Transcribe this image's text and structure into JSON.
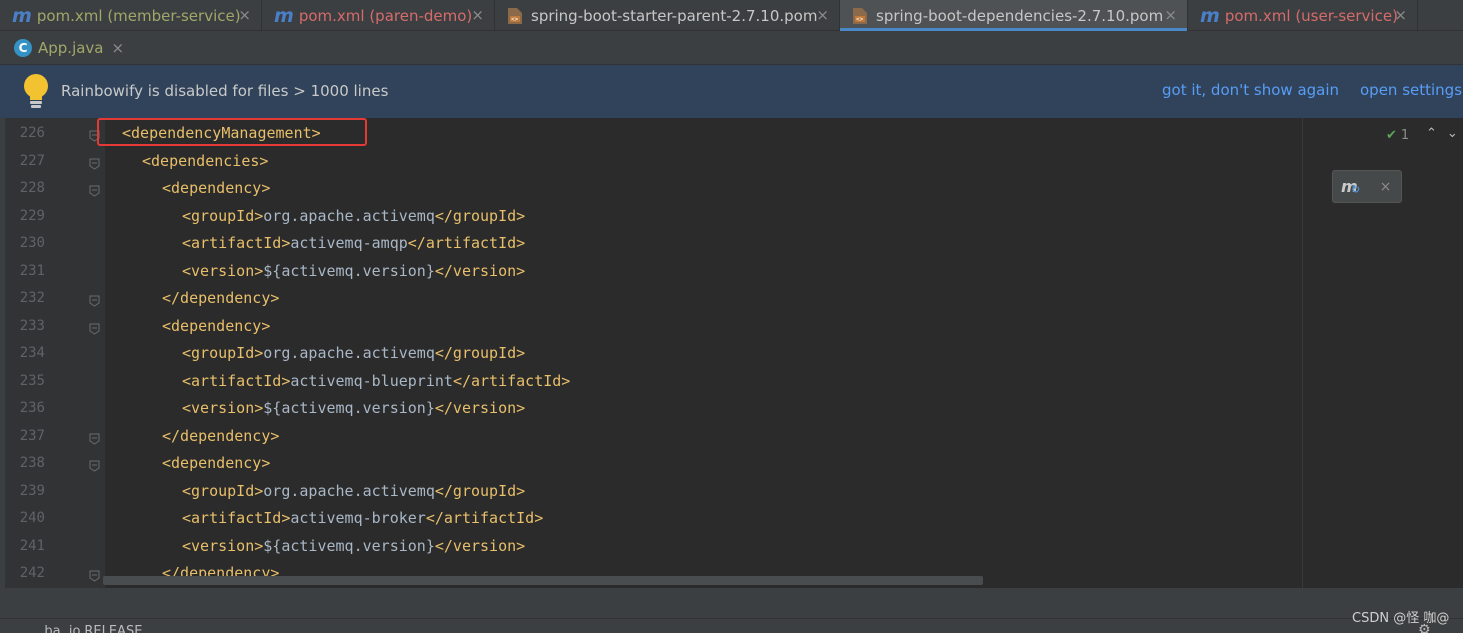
{
  "tabs": [
    {
      "label": "pom.xml (member-service)",
      "icon": "maven-icon",
      "color": "#a1a769"
    },
    {
      "label": "pom.xml (paren-demo)",
      "icon": "maven-icon",
      "color": "#d56b6b"
    },
    {
      "label": "spring-boot-starter-parent-2.7.10.pom",
      "icon": "pom-file-icon",
      "color": "#c7c7c7"
    },
    {
      "label": "spring-boot-dependencies-2.7.10.pom",
      "icon": "pom-file-icon",
      "color": "#c7c7c7",
      "active": true
    },
    {
      "label": "pom.xml (user-service)",
      "icon": "maven-icon",
      "color": "#d56b6b"
    }
  ],
  "tabs_row2": [
    {
      "label": "App.java",
      "icon": "java-class-icon"
    }
  ],
  "banner": {
    "message": "Rainbowify is disabled for files > 1000 lines",
    "link_dismiss": "got it, don't show again",
    "link_settings": "open settings"
  },
  "editor": {
    "lines": [
      {
        "num": "226",
        "indent": 0,
        "parts": [
          {
            "t": "tag",
            "v": "<dependencyManagement>"
          }
        ]
      },
      {
        "num": "227",
        "indent": 1,
        "parts": [
          {
            "t": "tag",
            "v": "<dependencies>"
          }
        ]
      },
      {
        "num": "228",
        "indent": 2,
        "parts": [
          {
            "t": "tag",
            "v": "<dependency>"
          }
        ]
      },
      {
        "num": "229",
        "indent": 3,
        "parts": [
          {
            "t": "tag",
            "v": "<groupId>"
          },
          {
            "t": "txt",
            "v": "org.apache.activemq"
          },
          {
            "t": "tag",
            "v": "</groupId>"
          }
        ]
      },
      {
        "num": "230",
        "indent": 3,
        "parts": [
          {
            "t": "tag",
            "v": "<artifactId>"
          },
          {
            "t": "txt",
            "v": "activemq-amqp"
          },
          {
            "t": "tag",
            "v": "</artifactId>"
          }
        ]
      },
      {
        "num": "231",
        "indent": 3,
        "parts": [
          {
            "t": "tag",
            "v": "<version>"
          },
          {
            "t": "txt",
            "v": "${activemq.version}"
          },
          {
            "t": "tag",
            "v": "</version>"
          }
        ]
      },
      {
        "num": "232",
        "indent": 2,
        "parts": [
          {
            "t": "tag",
            "v": "</dependency>"
          }
        ]
      },
      {
        "num": "233",
        "indent": 2,
        "parts": [
          {
            "t": "tag",
            "v": "<dependency>"
          }
        ]
      },
      {
        "num": "234",
        "indent": 3,
        "parts": [
          {
            "t": "tag",
            "v": "<groupId>"
          },
          {
            "t": "txt",
            "v": "org.apache.activemq"
          },
          {
            "t": "tag",
            "v": "</groupId>"
          }
        ]
      },
      {
        "num": "235",
        "indent": 3,
        "parts": [
          {
            "t": "tag",
            "v": "<artifactId>"
          },
          {
            "t": "txt",
            "v": "activemq-blueprint"
          },
          {
            "t": "tag",
            "v": "</artifactId>"
          }
        ]
      },
      {
        "num": "236",
        "indent": 3,
        "parts": [
          {
            "t": "tag",
            "v": "<version>"
          },
          {
            "t": "txt",
            "v": "${activemq.version}"
          },
          {
            "t": "tag",
            "v": "</version>"
          }
        ]
      },
      {
        "num": "237",
        "indent": 2,
        "parts": [
          {
            "t": "tag",
            "v": "</dependency>"
          }
        ]
      },
      {
        "num": "238",
        "indent": 2,
        "parts": [
          {
            "t": "tag",
            "v": "<dependency>"
          }
        ]
      },
      {
        "num": "239",
        "indent": 3,
        "parts": [
          {
            "t": "tag",
            "v": "<groupId>"
          },
          {
            "t": "txt",
            "v": "org.apache.activemq"
          },
          {
            "t": "tag",
            "v": "</groupId>"
          }
        ]
      },
      {
        "num": "240",
        "indent": 3,
        "parts": [
          {
            "t": "tag",
            "v": "<artifactId>"
          },
          {
            "t": "txt",
            "v": "activemq-broker"
          },
          {
            "t": "tag",
            "v": "</artifactId>"
          }
        ]
      },
      {
        "num": "241",
        "indent": 3,
        "parts": [
          {
            "t": "tag",
            "v": "<version>"
          },
          {
            "t": "txt",
            "v": "${activemq.version}"
          },
          {
            "t": "tag",
            "v": "</version>"
          }
        ]
      },
      {
        "num": "242",
        "indent": 2,
        "parts": [
          {
            "t": "tag",
            "v": "</dependency>"
          }
        ]
      }
    ],
    "inspection_count": "1"
  },
  "status": {
    "left_text": "...ba..io.RELEASE",
    "watermark": "CSDN @怪 咖@"
  },
  "colors": {
    "tag": "#e8bf6a",
    "text": "#a9b7c6",
    "highlight_box": "#e53935",
    "accent": "#4a88c7"
  }
}
